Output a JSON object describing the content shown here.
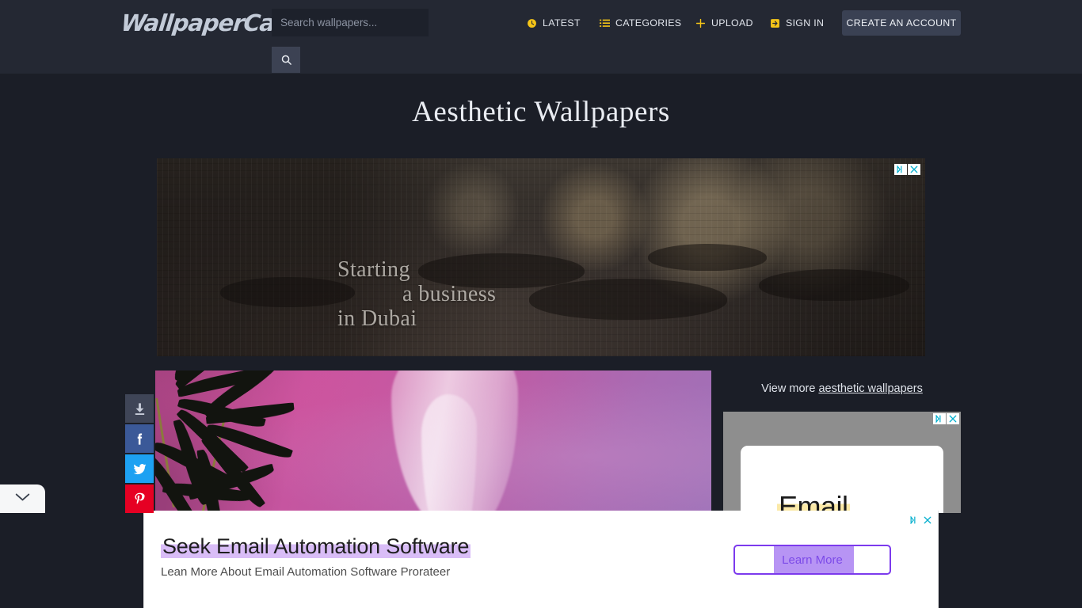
{
  "header": {
    "logo": "WallpaperCave",
    "search": {
      "value": "",
      "placeholder": "Search wallpapers...",
      "button_icon": "search-icon"
    },
    "nav": [
      {
        "label": "LATEST",
        "icon": "clock-icon"
      },
      {
        "label": "CATEGORIES",
        "icon": "list-icon"
      },
      {
        "label": "UPLOAD",
        "icon": "plus-icon"
      },
      {
        "label": "SIGN IN",
        "icon": "login-icon"
      }
    ],
    "create_account_label": "CREATE AN ACCOUNT",
    "accent_color": "#f5c518",
    "background_color": "#242833"
  },
  "page": {
    "title": "Aesthetic Wallpapers",
    "background_color": "#1b1e27"
  },
  "banner_ad": {
    "line1": "Starting",
    "line2": "a business",
    "line3": "in Dubai",
    "adchoices_icon": "adchoices-triangle-icon",
    "close_icon": "close-icon"
  },
  "share": {
    "buttons": [
      {
        "name": "download",
        "icon": "download-icon",
        "color": "#3f4557"
      },
      {
        "name": "facebook",
        "icon": "facebook-icon",
        "color": "#3b5998"
      },
      {
        "name": "twitter",
        "icon": "twitter-icon",
        "color": "#1da1f2"
      },
      {
        "name": "pinterest",
        "icon": "pinterest-icon",
        "color": "#e60023"
      }
    ],
    "collapse_icon": "chevron-down-icon"
  },
  "sidebar": {
    "view_more_prefix": "View more ",
    "view_more_link": "aesthetic wallpapers",
    "ad": {
      "word": "Email",
      "adchoices_icon": "adchoices-triangle-icon",
      "close_icon": "close-icon"
    }
  },
  "bottom_ad": {
    "headline": "Seek Email Automation Software",
    "subtext": "Lean More About Email Automation Software Prorateer",
    "button_label": "Learn More",
    "accent_color": "#7c3aed",
    "adchoices_icon": "adchoices-triangle-icon",
    "close_icon": "close-icon"
  }
}
